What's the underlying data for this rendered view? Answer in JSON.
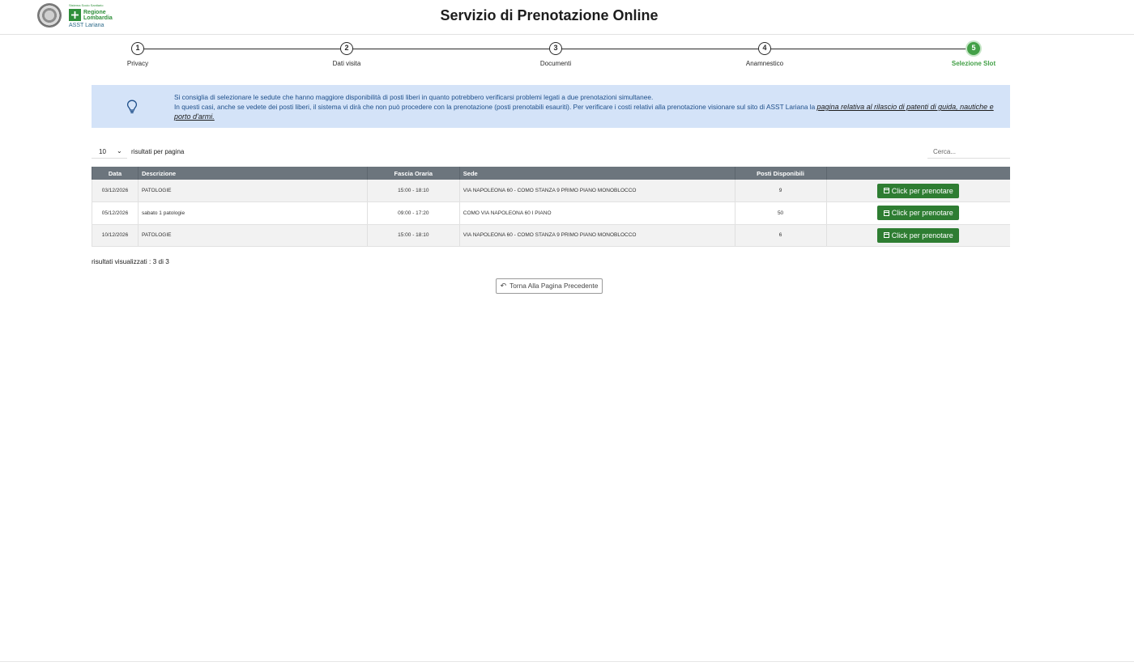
{
  "header": {
    "title": "Servizio di Prenotazione Online",
    "brand_top": "Sistema Socio Sanitario",
    "brand_name": "Regione Lombardia",
    "brand_sub": "ASST Lariana"
  },
  "stepper": {
    "steps": [
      {
        "number": "1",
        "label": "Privacy"
      },
      {
        "number": "2",
        "label": "Dati visita"
      },
      {
        "number": "3",
        "label": "Documenti"
      },
      {
        "number": "4",
        "label": "Anamnestico"
      },
      {
        "number": "5",
        "label": "Selezione Slot"
      }
    ],
    "active_step": "5",
    "active_color": "#43a047"
  },
  "info": {
    "line1": "Si consiglia di selezionare le sedute che hanno maggiore disponibilità di posti liberi in quanto potrebbero verificarsi problemi legati a due prenotazioni simultanee.",
    "line2": "In questi casi, anche se vedete dei posti liberi, il sistema vi dirà che non può procedere con la prenotazione (posti prenotabili esauriti). Per verificare i costi relativi alla prenotazione visionare sul sito di ASST Lariana la ",
    "link": "pagina relativa al rilascio di patenti di guida, nautiche e porto d'armi.",
    "icon": "lightbulb-icon",
    "background": "#d4e3f8"
  },
  "controls": {
    "page_length": "10",
    "page_length_label": "risultati per pagina",
    "search_placeholder": "Cerca..."
  },
  "table": {
    "headers": [
      "Data",
      "Descrizione",
      "Fascia Oraria",
      "Sede",
      "Posti Disponibili",
      ""
    ],
    "rows": [
      {
        "date": "03/12/2026",
        "description": "PATOLOGIE",
        "time": "15:00 - 18:10",
        "location": "VIA NAPOLEONA 60 - COMO STANZA 9 PRIMO PIANO MONOBLOCCO",
        "seats": "9",
        "action": "Click per prenotare"
      },
      {
        "date": "05/12/2026",
        "description": "sabato 1 patologie",
        "time": "09:00 - 17:20",
        "location": "COMO VIA NAPOLEONA 60 I PIANO",
        "seats": "50",
        "action": "Click per prenotare"
      },
      {
        "date": "10/12/2026",
        "description": "PATOLOGIE",
        "time": "15:00 - 18:10",
        "location": "VIA NAPOLEONA 60 - COMO STANZA 9 PRIMO PIANO MONOBLOCCO",
        "seats": "6",
        "action": "Click per prenotare"
      }
    ],
    "header_color": "#6c757d",
    "button_color": "#2e7d32"
  },
  "footer": {
    "results_info": "risultati visualizzati : 3 di 3",
    "back_button": "Torna Alla Pagina Precedente"
  }
}
